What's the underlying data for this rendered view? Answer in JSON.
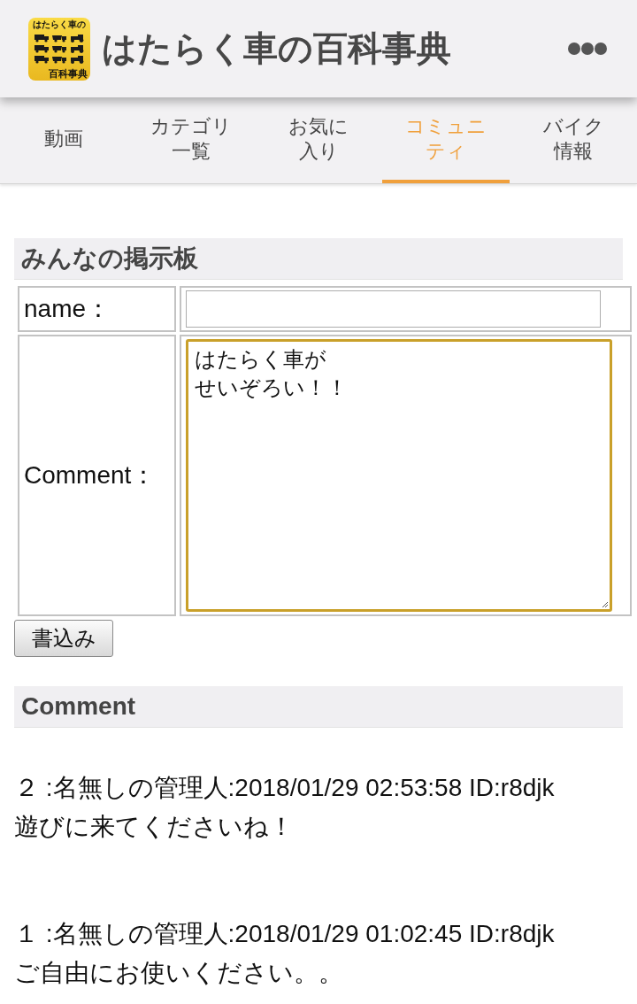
{
  "app_bar": {
    "logo_lines": [
      "はたらく車の",
      "百科事典"
    ],
    "title": "はたらく車の百科事典"
  },
  "tabs": [
    {
      "label": "動画",
      "selected": false
    },
    {
      "label": "カテゴリ一覧",
      "selected": false
    },
    {
      "label": "お気に入り",
      "selected": false
    },
    {
      "label": "コミュニティ",
      "selected": true
    },
    {
      "label": "バイク情報",
      "selected": false
    }
  ],
  "board": {
    "title": "みんなの掲示板",
    "name_label": "name：",
    "comment_label": "Comment：",
    "comment_lines": [
      "はたらく車が",
      "せいぞろい！！"
    ],
    "comment_focused": true,
    "submit_button": "書込み"
  },
  "comments": {
    "title": "Comment",
    "posts": [
      {
        "header": "２ :名無しの管理人:2018/01/29 02:53:58 ID:r8djk",
        "body": "遊びに来てくださいね！"
      },
      {
        "header": "１ :名無しの管理人:2018/01/29 01:02:45 ID:r8djk",
        "body": "ご自由にお使いください。。"
      }
    ]
  }
}
